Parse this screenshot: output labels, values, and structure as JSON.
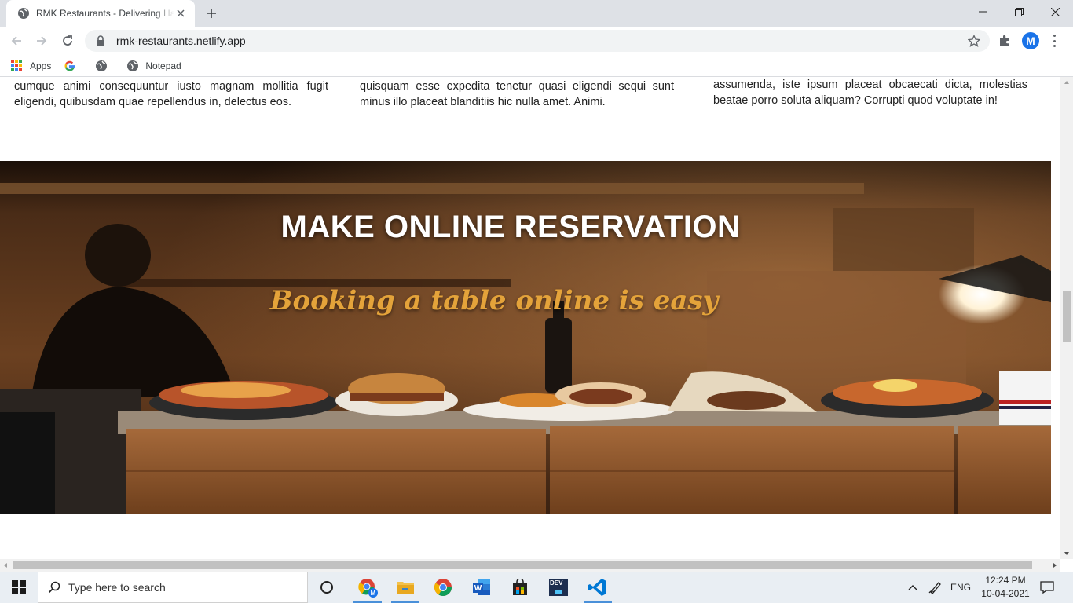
{
  "browser": {
    "tab_title": "RMK Restaurants - Delivering Happiness",
    "url": "rmk-restaurants.netlify.app",
    "bookmarks": [
      {
        "label": "Apps"
      },
      {
        "label": ""
      },
      {
        "label": ""
      },
      {
        "label": "Notepad"
      }
    ],
    "profile_initial": "M"
  },
  "page": {
    "columns": [
      "cumque animi consequuntur iusto magnam mollitia fugit eligendi, quibusdam quae repellendus in, delectus eos.",
      "quisquam esse expedita tenetur quasi eligendi sequi sunt minus illo placeat blanditiis hic nulla amet. Animi.",
      "assumenda, iste ipsum placeat obcaecati dicta, molestias beatae porro soluta aliquam? Corrupti quod voluptate in!"
    ],
    "hero": {
      "title": "MAKE ONLINE RESERVATION",
      "subtitle": "Booking a table online is easy"
    }
  },
  "taskbar": {
    "search_placeholder": "Type here to search",
    "language": "ENG",
    "time": "12:24 PM",
    "date": "10-04-2021",
    "dev_label": "DEV"
  },
  "colors": {
    "accent_gold": "#e4a33a",
    "chrome_frame": "#dee1e6",
    "vscode_blue": "#0078d4"
  }
}
